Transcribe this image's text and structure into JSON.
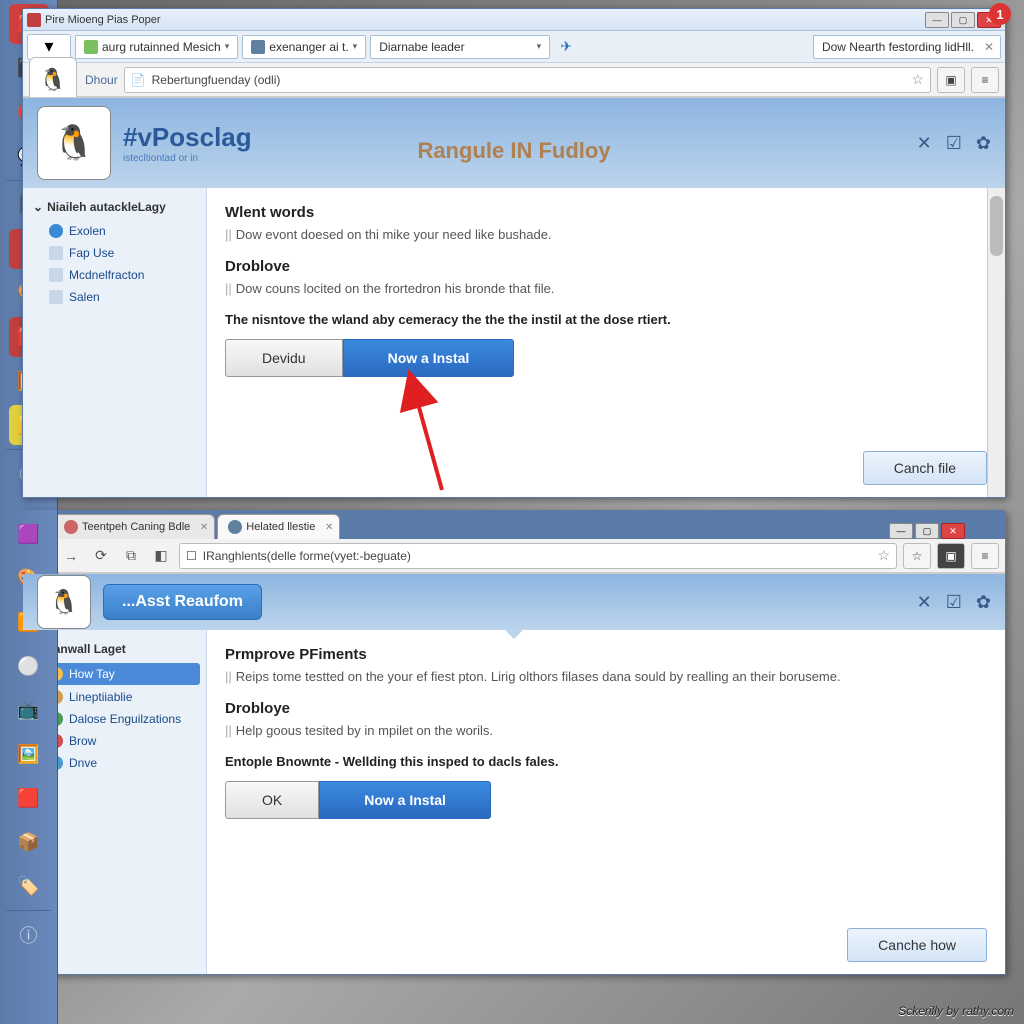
{
  "taskbar_icons": [
    "app",
    "user",
    "chat",
    "star",
    "fav",
    "pic",
    "gal",
    "note",
    "img",
    "vid",
    "doc",
    "set",
    "mus",
    "info"
  ],
  "win1": {
    "title": "Pire Mioeng Pias Poper",
    "bookmarks": [
      "aurg rutainned Mesich",
      "exenanger ai t.",
      "Diarnabe leader"
    ],
    "tab_right": "Dow Nearth  festording lidHll.",
    "address": "Rebertungfuenday (odli)",
    "logo_label": "Dhour",
    "badge": "1",
    "page_title": "#vPosclag",
    "page_sub": "istecltiontad or in",
    "teaser": "Rangule IN Fudloy",
    "sidebar_header": "Niaileh autackleLagy",
    "sidebar": [
      {
        "label": "Exolen",
        "ico": "#3a8ad8"
      },
      {
        "label": "Fap Use",
        "ico": "#c8d8e8"
      },
      {
        "label": "Mcdnelfracton",
        "ico": "#c8d8e8"
      },
      {
        "label": "Salen",
        "ico": "#c8d8e8"
      }
    ],
    "h1": "Wlent words",
    "p1": "Dow evont doesed on thi mike your need like bushade.",
    "h2": "Droblove",
    "p2": "Dow couns locited on the frortedron his bronde that file.",
    "bold": "The nisntove the wland aby cemeracy the the the instil at the dose rtiert.",
    "btn_gray": "Devidu",
    "btn_blue": "Now a Instal",
    "cancel": "Canch file"
  },
  "win2": {
    "tabs": [
      "Teentpeh Caning Bdle",
      "Helated llestie"
    ],
    "address": "IRanghlents(delle forme(vyet:-beguate)",
    "chip": "...Asst Reaufom",
    "sidebar_header": "llanwall Laget",
    "sidebar": [
      {
        "label": "How Tay",
        "sel": true,
        "ico": "#f5c050"
      },
      {
        "label": "Lineptiiablie",
        "ico": "#d0a050"
      },
      {
        "label": "Dalose Enguilzations",
        "ico": "#4a9a5a"
      },
      {
        "label": "Brow",
        "ico": "#d05050"
      },
      {
        "label": "Dnve",
        "ico": "#4a9ad0"
      }
    ],
    "h1": "Prmprove PFiments",
    "p1": "Reips tome testted on the your ef fiest pton. Lirig olthors filases dana sould by realling an their boruseme.",
    "h2": "Drobloye",
    "p2": "Help goous tesited by in mpilet on the worils.",
    "bold": "Entople Bnownte - Wellding this insped to dacls fales.",
    "btn_gray": "OK",
    "btn_blue": "Now a Instal",
    "cancel": "Canche how"
  },
  "watermark": "Sckerilly by rathy.com"
}
